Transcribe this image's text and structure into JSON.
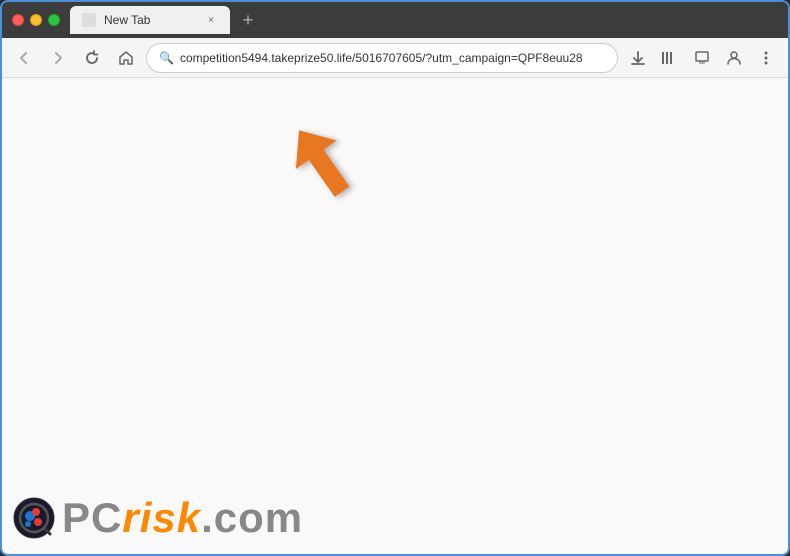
{
  "browser": {
    "tab": {
      "title": "New Tab",
      "close_label": "×"
    },
    "new_tab_label": "+",
    "nav": {
      "back_label": "‹",
      "forward_label": "›",
      "reload_label": "↻",
      "home_label": "⌂",
      "address": "competition5494.takeprize50.life/5016707605/?utm_campaign=QPF8euu28",
      "download_label": "⬇",
      "bookmarks_label": "|||",
      "synced_tabs_label": "⊡",
      "profile_label": "👤",
      "menu_label": "≡"
    }
  },
  "watermark": {
    "pc_text": "PC",
    "risk_text": "risk",
    "com_text": ".com"
  },
  "colors": {
    "accent": "#4a90d9",
    "orange": "#e87722"
  }
}
